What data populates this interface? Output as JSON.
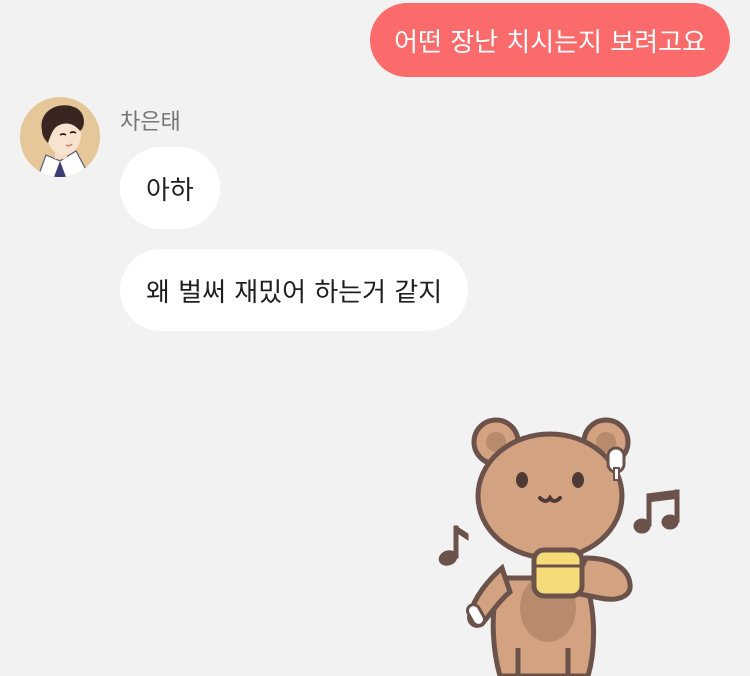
{
  "chat": {
    "outgoing": [
      {
        "text": "어떤 장난 치시는지 보려고요"
      }
    ],
    "incoming": {
      "sender": "차은태",
      "avatar_icon": "profile-avatar-icon",
      "messages": [
        {
          "text": "아하"
        },
        {
          "text": "왜 벌써 재밌어 하는거 같지"
        }
      ],
      "sticker_icon": "bear-with-earphones-sticker-icon"
    }
  },
  "colors": {
    "background": "#f2f2f2",
    "outgoing_bubble": "#fb6b6b",
    "incoming_bubble": "#ffffff",
    "sender_name": "#767676"
  }
}
